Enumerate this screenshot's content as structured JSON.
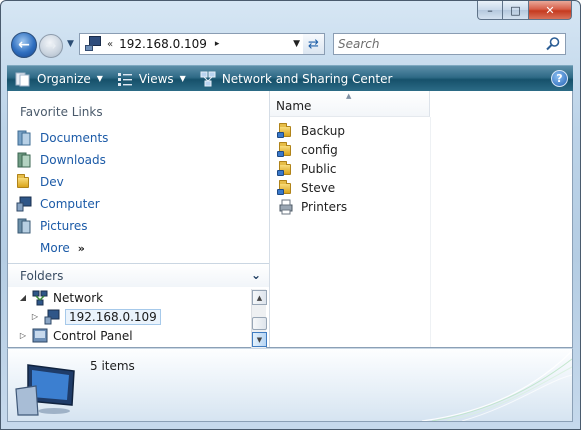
{
  "window": {
    "minimize_label": "–",
    "maximize_label": "□",
    "close_label": "✕"
  },
  "address_bar": {
    "overflow_chevron": "«",
    "path": "192.168.0.109",
    "separator": "▸",
    "icon": "network-computer-icon"
  },
  "search": {
    "placeholder": "Search"
  },
  "commands": {
    "organize": "Organize",
    "views": "Views",
    "network_sharing": "Network and Sharing Center"
  },
  "favorite_links": {
    "title": "Favorite Links",
    "items": [
      {
        "label": "Documents",
        "icon": "documents-icon"
      },
      {
        "label": "Downloads",
        "icon": "downloads-icon"
      },
      {
        "label": "Dev",
        "icon": "folder-icon"
      },
      {
        "label": "Computer",
        "icon": "computer-icon"
      },
      {
        "label": "Pictures",
        "icon": "pictures-icon"
      }
    ],
    "more": "More",
    "more_chevron": "»"
  },
  "folders": {
    "title": "Folders",
    "tree": [
      {
        "label": "Network",
        "expander": "◢",
        "icon": "network-icon"
      },
      {
        "label": "192.168.0.109",
        "expander": "▷",
        "icon": "network-computer-icon",
        "selected": true
      },
      {
        "label": "Control Panel",
        "expander": "▷",
        "icon": "control-panel-icon"
      }
    ]
  },
  "content": {
    "column_name": "Name",
    "files": [
      {
        "label": "Backup",
        "icon": "shared-folder-icon"
      },
      {
        "label": "config",
        "icon": "shared-folder-icon"
      },
      {
        "label": "Public",
        "icon": "shared-folder-icon"
      },
      {
        "label": "Steve",
        "icon": "shared-folder-icon"
      },
      {
        "label": "Printers",
        "icon": "printers-icon"
      }
    ]
  },
  "details": {
    "count_text": "5 items"
  }
}
